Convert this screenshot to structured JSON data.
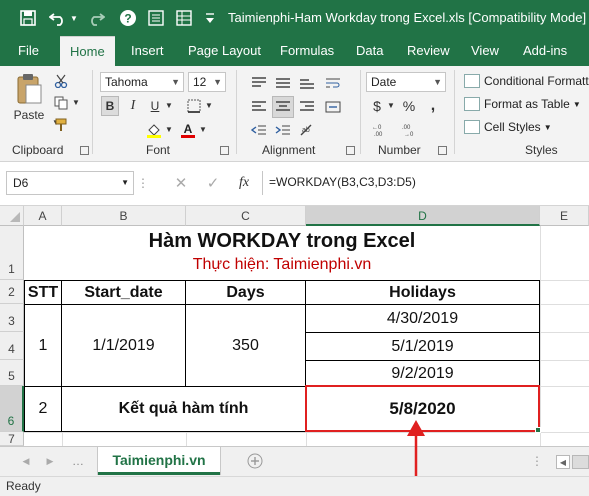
{
  "window": {
    "title": "Taimienphi-Ham Workday trong Excel.xls  [Compatibility Mode]",
    "quick_access": [
      "save-icon",
      "undo-icon",
      "redo-icon",
      "help-icon",
      "form-icon",
      "table-icon",
      "customize-icon"
    ]
  },
  "tabs": [
    "File",
    "Home",
    "Insert",
    "Page Layout",
    "Formulas",
    "Data",
    "Review",
    "View",
    "Add-ins"
  ],
  "active_tab": "Home",
  "ribbon": {
    "clipboard": {
      "label": "Clipboard",
      "paste": "Paste"
    },
    "font": {
      "label": "Font",
      "name": "Tahoma",
      "size": "12",
      "bold": "B",
      "italic": "I",
      "underline": "U"
    },
    "alignment": {
      "label": "Alignment"
    },
    "number": {
      "label": "Number",
      "format": "Date",
      "currency": "$",
      "percent": "%",
      "comma": ","
    },
    "styles": {
      "label": "Styles",
      "conditional": "Conditional Formatti",
      "format_table": "Format as Table",
      "cell_styles": "Cell Styles"
    }
  },
  "formula_bar": {
    "name_box": "D6",
    "fx": "fx",
    "formula": "=WORKDAY(B3,C3,D3:D5)"
  },
  "columns": [
    "A",
    "B",
    "C",
    "D",
    "E"
  ],
  "rows": [
    "1",
    "2",
    "3",
    "4",
    "5",
    "6",
    "7"
  ],
  "sheet": {
    "title": "Hàm WORKDAY trong Excel",
    "subtitle": "Thực hiện: Taimienphi.vn",
    "headers": [
      "STT",
      "Start_date",
      "Days",
      "Holidays"
    ],
    "stt": "1",
    "start_date": "1/1/2019",
    "days": "350",
    "holidays": [
      "4/30/2019",
      "5/1/2019",
      "9/2/2019"
    ],
    "result_stt": "2",
    "result_label": "Kết quả hàm tính",
    "result_value": "5/8/2020"
  },
  "sheet_tabs": [
    "Taimienphi.vn"
  ],
  "status": "Ready",
  "colors": {
    "excel_green": "#217346",
    "subtitle_red": "#c00000",
    "highlight_red": "#e02020"
  }
}
